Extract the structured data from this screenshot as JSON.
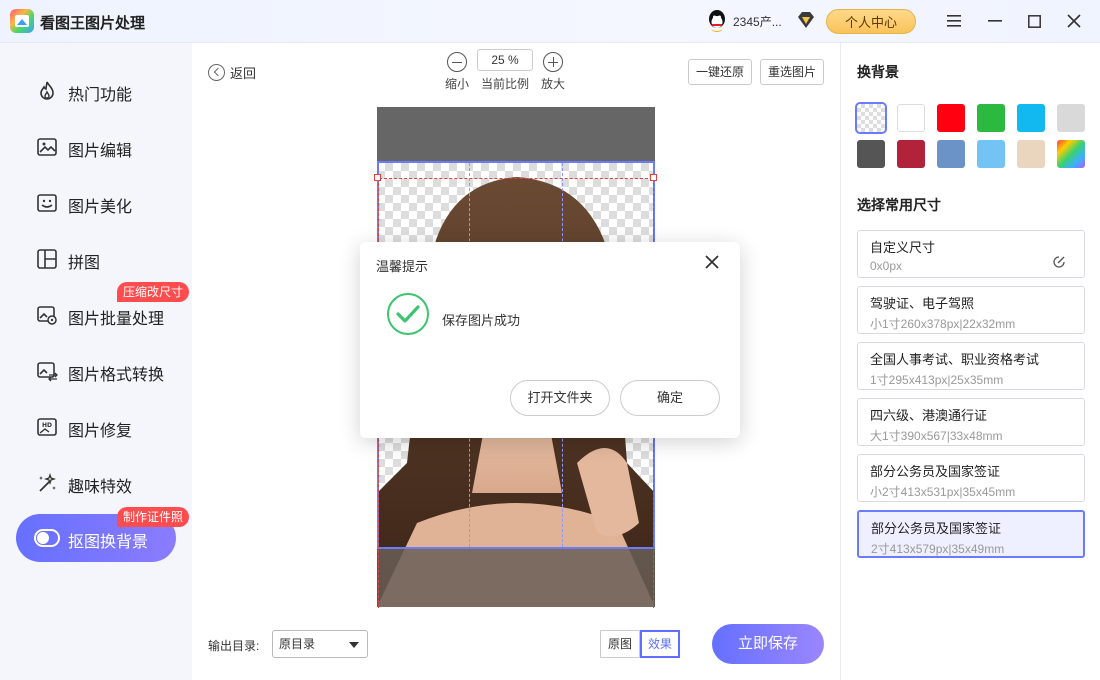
{
  "app": {
    "title": "看图王图片处理",
    "user": "2345产...",
    "center_label": "个人中心"
  },
  "sidebar": {
    "items": [
      {
        "label": "热门功能"
      },
      {
        "label": "图片编辑"
      },
      {
        "label": "图片美化"
      },
      {
        "label": "拼图"
      },
      {
        "label": "图片批量处理",
        "tag": "压缩改尺寸"
      },
      {
        "label": "图片格式转换"
      },
      {
        "label": "图片修复"
      },
      {
        "label": "趣味特效"
      },
      {
        "label": "抠图换背景",
        "tag": "制作证件照",
        "active": true
      }
    ]
  },
  "toolbar": {
    "back_label": "返回",
    "zoom_out_label": "缩小",
    "zoom_value": "25 %",
    "zoom_ratio_label": "当前比例",
    "zoom_in_label": "放大",
    "reset_label": "一键还原",
    "reselect_label": "重选图片"
  },
  "bottom": {
    "output_label": "输出目录:",
    "output_value": "原目录",
    "original_label": "原图",
    "effect_label": "效果",
    "save_label": "立即保存"
  },
  "right": {
    "bg_title": "换背景",
    "swatches": [
      "transparent",
      "#ffffff",
      "#ff0011",
      "#2bb93f",
      "#12b8f0",
      "#d9d9d9",
      "#555555",
      "#b0233a",
      "#6b93c8",
      "#73c4f5",
      "#ead5bf",
      "rainbow"
    ],
    "size_title": "选择常用尺寸",
    "sizes": [
      {
        "name": "自定义尺寸",
        "spec": "0x0px"
      },
      {
        "name": "驾驶证、电子驾照",
        "spec": "小1寸260x378px|22x32mm"
      },
      {
        "name": "全国人事考试、职业资格考试",
        "spec": "1寸295x413px|25x35mm"
      },
      {
        "name": "四六级、港澳通行证",
        "spec": "大1寸390x567|33x48mm"
      },
      {
        "name": "部分公务员及国家签证",
        "spec": "小2寸413x531px|35x45mm"
      },
      {
        "name": "部分公务员及国家签证",
        "spec": "2寸413x579px|35x49mm",
        "active": true
      }
    ]
  },
  "dialog": {
    "title": "温馨提示",
    "message": "保存图片成功",
    "open_folder_label": "打开文件夹",
    "ok_label": "确定"
  },
  "colors": {
    "accent": "#6b7bff",
    "tag_red": "#ff4d4f",
    "success": "#3cc46e"
  }
}
